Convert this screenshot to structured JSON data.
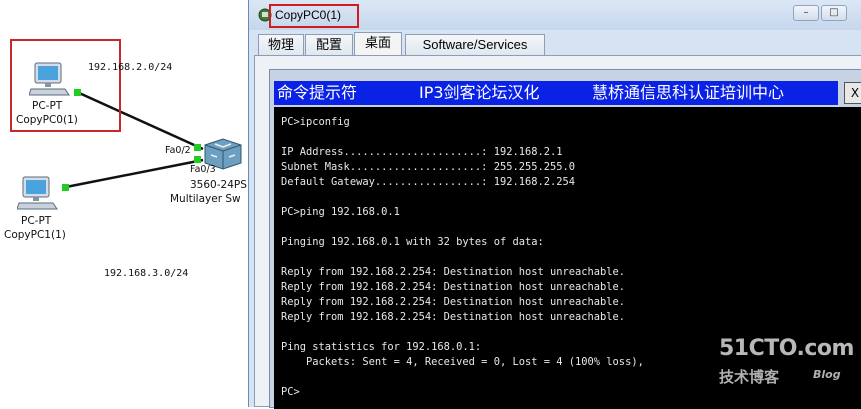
{
  "topology": {
    "devices": [
      {
        "type": "PC-PT",
        "name": "CopyPC0(1)"
      },
      {
        "type": "PC-PT",
        "name": "CopyPC1(1)"
      },
      {
        "type": "3560-24PS",
        "name": "Multilayer Sw"
      }
    ],
    "networks": [
      "192.168.2.0/24",
      "192.168.3.0/24"
    ],
    "ports": [
      "Fa0/2",
      "Fa0/3"
    ],
    "link_color": "#22cc22"
  },
  "window": {
    "title": "CopyPC0(1)",
    "controls": [
      "–",
      "□"
    ],
    "tabs": [
      "物理",
      "配置",
      "桌面",
      "Software/Services"
    ],
    "active_tab": "桌面"
  },
  "terminal": {
    "title_parts": [
      "命令提示符",
      "IP3剑客论坛汉化",
      "慧桥通信思科认证培训中心"
    ],
    "close_label": "X",
    "title_bg": "#0a22e6",
    "lines": [
      "PC>ipconfig",
      "",
      "IP Address......................: 192.168.2.1",
      "Subnet Mask.....................: 255.255.255.0",
      "Default Gateway.................: 192.168.2.254",
      "",
      "PC>ping 192.168.0.1",
      "",
      "Pinging 192.168.0.1 with 32 bytes of data:",
      "",
      "Reply from 192.168.2.254: Destination host unreachable.",
      "Reply from 192.168.2.254: Destination host unreachable.",
      "Reply from 192.168.2.254: Destination host unreachable.",
      "Reply from 192.168.2.254: Destination host unreachable.",
      "",
      "Ping statistics for 192.168.0.1:",
      "    Packets: Sent = 4, Received = 0, Lost = 4 (100% loss),",
      "",
      "PC>"
    ]
  },
  "watermark": {
    "main": "51CTO.com",
    "sub": "技术博客",
    "blog": "Blog"
  }
}
